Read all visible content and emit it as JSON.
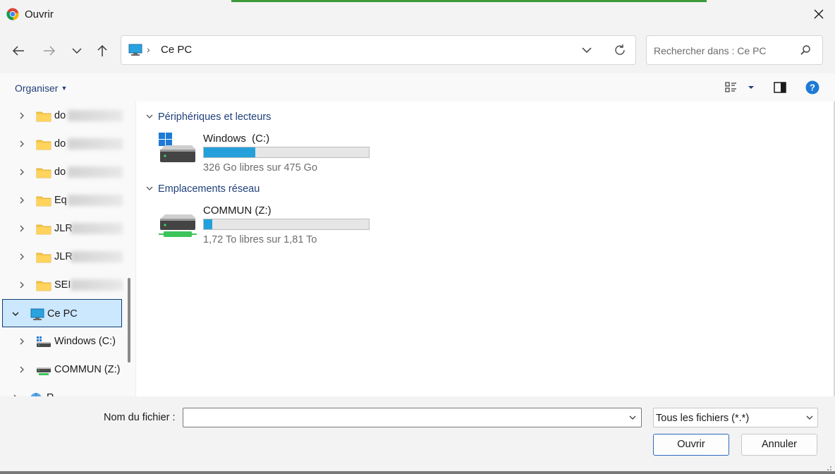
{
  "window": {
    "title": "Ouvrir",
    "accent": "#3d9a3b"
  },
  "nav": {
    "back_icon": "arrow-left-icon",
    "forward_icon": "arrow-right-icon",
    "recent_icon": "chevron-down-icon",
    "up_icon": "arrow-up-icon",
    "address": {
      "separator": "›",
      "location": "Ce PC"
    },
    "search": {
      "placeholder": "Rechercher dans : Ce PC"
    }
  },
  "toolbar": {
    "organise_label": "Organiser"
  },
  "sidebar": {
    "items": [
      {
        "label": "do",
        "icon": "folder-icon",
        "blurred": true
      },
      {
        "label": "do",
        "icon": "folder-icon",
        "blurred": true
      },
      {
        "label": "do",
        "icon": "folder-icon",
        "blurred": true
      },
      {
        "label": "Eq",
        "icon": "folder-icon",
        "blurred": true
      },
      {
        "label": "JLR",
        "icon": "folder-icon",
        "blurred": true
      },
      {
        "label": "JLR",
        "icon": "folder-icon",
        "blurred": true
      },
      {
        "label": "SEI",
        "icon": "folder-icon",
        "blurred": true
      },
      {
        "label": "Ce PC",
        "icon": "computer-icon",
        "selected": true
      },
      {
        "label": "Windows  (C:)",
        "icon": "windows-drive-icon"
      },
      {
        "label": "COMMUN (Z:)",
        "icon": "network-drive-icon"
      },
      {
        "label": "R",
        "icon": "network-icon"
      }
    ]
  },
  "content": {
    "groups": [
      {
        "title": "Périphériques et lecteurs",
        "drives": [
          {
            "name": "Windows  (C:)",
            "free_text": "326 Go libres sur 475 Go",
            "used_fraction": 0.31,
            "icon": "windows-drive-icon"
          }
        ]
      },
      {
        "title": "Emplacements réseau",
        "drives": [
          {
            "name": "COMMUN (Z:)",
            "free_text": "1,72 To libres sur 1,81 To",
            "used_fraction": 0.05,
            "icon": "network-drive-icon"
          }
        ]
      }
    ],
    "bar_color": "#26a0da"
  },
  "footer": {
    "filename_label": "Nom du fichier :",
    "filename_value": "",
    "filetype": "Tous les fichiers (*.*)",
    "open_label": "Ouvrir",
    "cancel_label": "Annuler"
  }
}
